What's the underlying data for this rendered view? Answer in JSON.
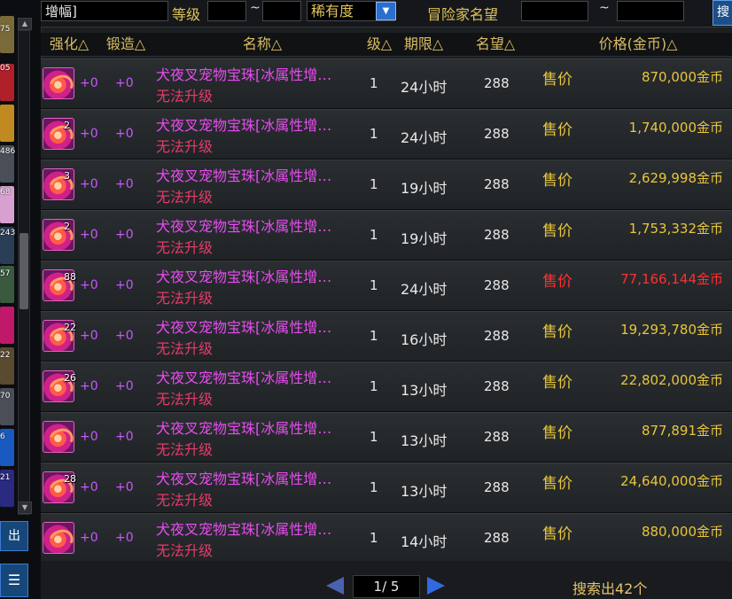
{
  "filters": {
    "name_value": "增幅]",
    "level_label": "等级",
    "level_min": "",
    "level_max": "",
    "tilde": "~",
    "rarity_value": "稀有度",
    "fame_label": "冒险家名望",
    "fame_min": "",
    "fame_max": "",
    "search_button_partial": "搜"
  },
  "left_strip": {
    "counts": [
      "75",
      "05",
      "486",
      "68",
      "243",
      "57",
      "22",
      "70",
      "6",
      "21"
    ],
    "exit_label": "出",
    "list_icon": "list-icon"
  },
  "columns": {
    "enhance": "强化△",
    "forge": "锻造△",
    "name": "名称△",
    "level": "级△",
    "duration": "期限△",
    "fame": "名望△",
    "price": "价格(金币)△"
  },
  "rows": [
    {
      "count": "",
      "enhance": "+0",
      "forge": "+0",
      "name": "犬夜叉宠物宝珠[冰属性增…",
      "status": "无法升级",
      "level": "1",
      "duration": "24小时",
      "fame": "288",
      "sell": "售价",
      "price": "870,000金币"
    },
    {
      "count": "2",
      "enhance": "+0",
      "forge": "+0",
      "name": "犬夜叉宠物宝珠[冰属性增…",
      "status": "无法升级",
      "level": "1",
      "duration": "24小时",
      "fame": "288",
      "sell": "售价",
      "price": "1,740,000金币"
    },
    {
      "count": "3",
      "enhance": "+0",
      "forge": "+0",
      "name": "犬夜叉宠物宝珠[冰属性增…",
      "status": "无法升级",
      "level": "1",
      "duration": "19小时",
      "fame": "288",
      "sell": "售价",
      "price": "2,629,998金币"
    },
    {
      "count": "2",
      "enhance": "+0",
      "forge": "+0",
      "name": "犬夜叉宠物宝珠[冰属性增…",
      "status": "无法升级",
      "level": "1",
      "duration": "19小时",
      "fame": "288",
      "sell": "售价",
      "price": "1,753,332金币"
    },
    {
      "count": "88",
      "enhance": "+0",
      "forge": "+0",
      "name": "犬夜叉宠物宝珠[冰属性增…",
      "status": "无法升级",
      "level": "1",
      "duration": "24小时",
      "fame": "288",
      "sell": "售价",
      "price": "77,166,144金币"
    },
    {
      "count": "22",
      "enhance": "+0",
      "forge": "+0",
      "name": "犬夜叉宠物宝珠[冰属性增…",
      "status": "无法升级",
      "level": "1",
      "duration": "16小时",
      "fame": "288",
      "sell": "售价",
      "price": "19,293,780金币"
    },
    {
      "count": "26",
      "enhance": "+0",
      "forge": "+0",
      "name": "犬夜叉宠物宝珠[冰属性增…",
      "status": "无法升级",
      "level": "1",
      "duration": "13小时",
      "fame": "288",
      "sell": "售价",
      "price": "22,802,000金币"
    },
    {
      "count": "",
      "enhance": "+0",
      "forge": "+0",
      "name": "犬夜叉宠物宝珠[冰属性增…",
      "status": "无法升级",
      "level": "1",
      "duration": "13小时",
      "fame": "288",
      "sell": "售价",
      "price": "877,891金币"
    },
    {
      "count": "28",
      "enhance": "+0",
      "forge": "+0",
      "name": "犬夜叉宠物宝珠[冰属性增…",
      "status": "无法升级",
      "level": "1",
      "duration": "13小时",
      "fame": "288",
      "sell": "售价",
      "price": "24,640,000金币"
    },
    {
      "count": "",
      "enhance": "+0",
      "forge": "+0",
      "name": "犬夜叉宠物宝珠[冰属性增…",
      "status": "无法升级",
      "level": "1",
      "duration": "14小时",
      "fame": "288",
      "sell": "售价",
      "price": "880,000金币"
    }
  ],
  "pagination": {
    "page_text": "1/ 5",
    "result_text": "搜索出42个"
  },
  "colors": {
    "price_normal": "#e9c53a",
    "price_hot": "#ff3030",
    "item_name": "#e84cf0",
    "status": "#e83a6a"
  }
}
